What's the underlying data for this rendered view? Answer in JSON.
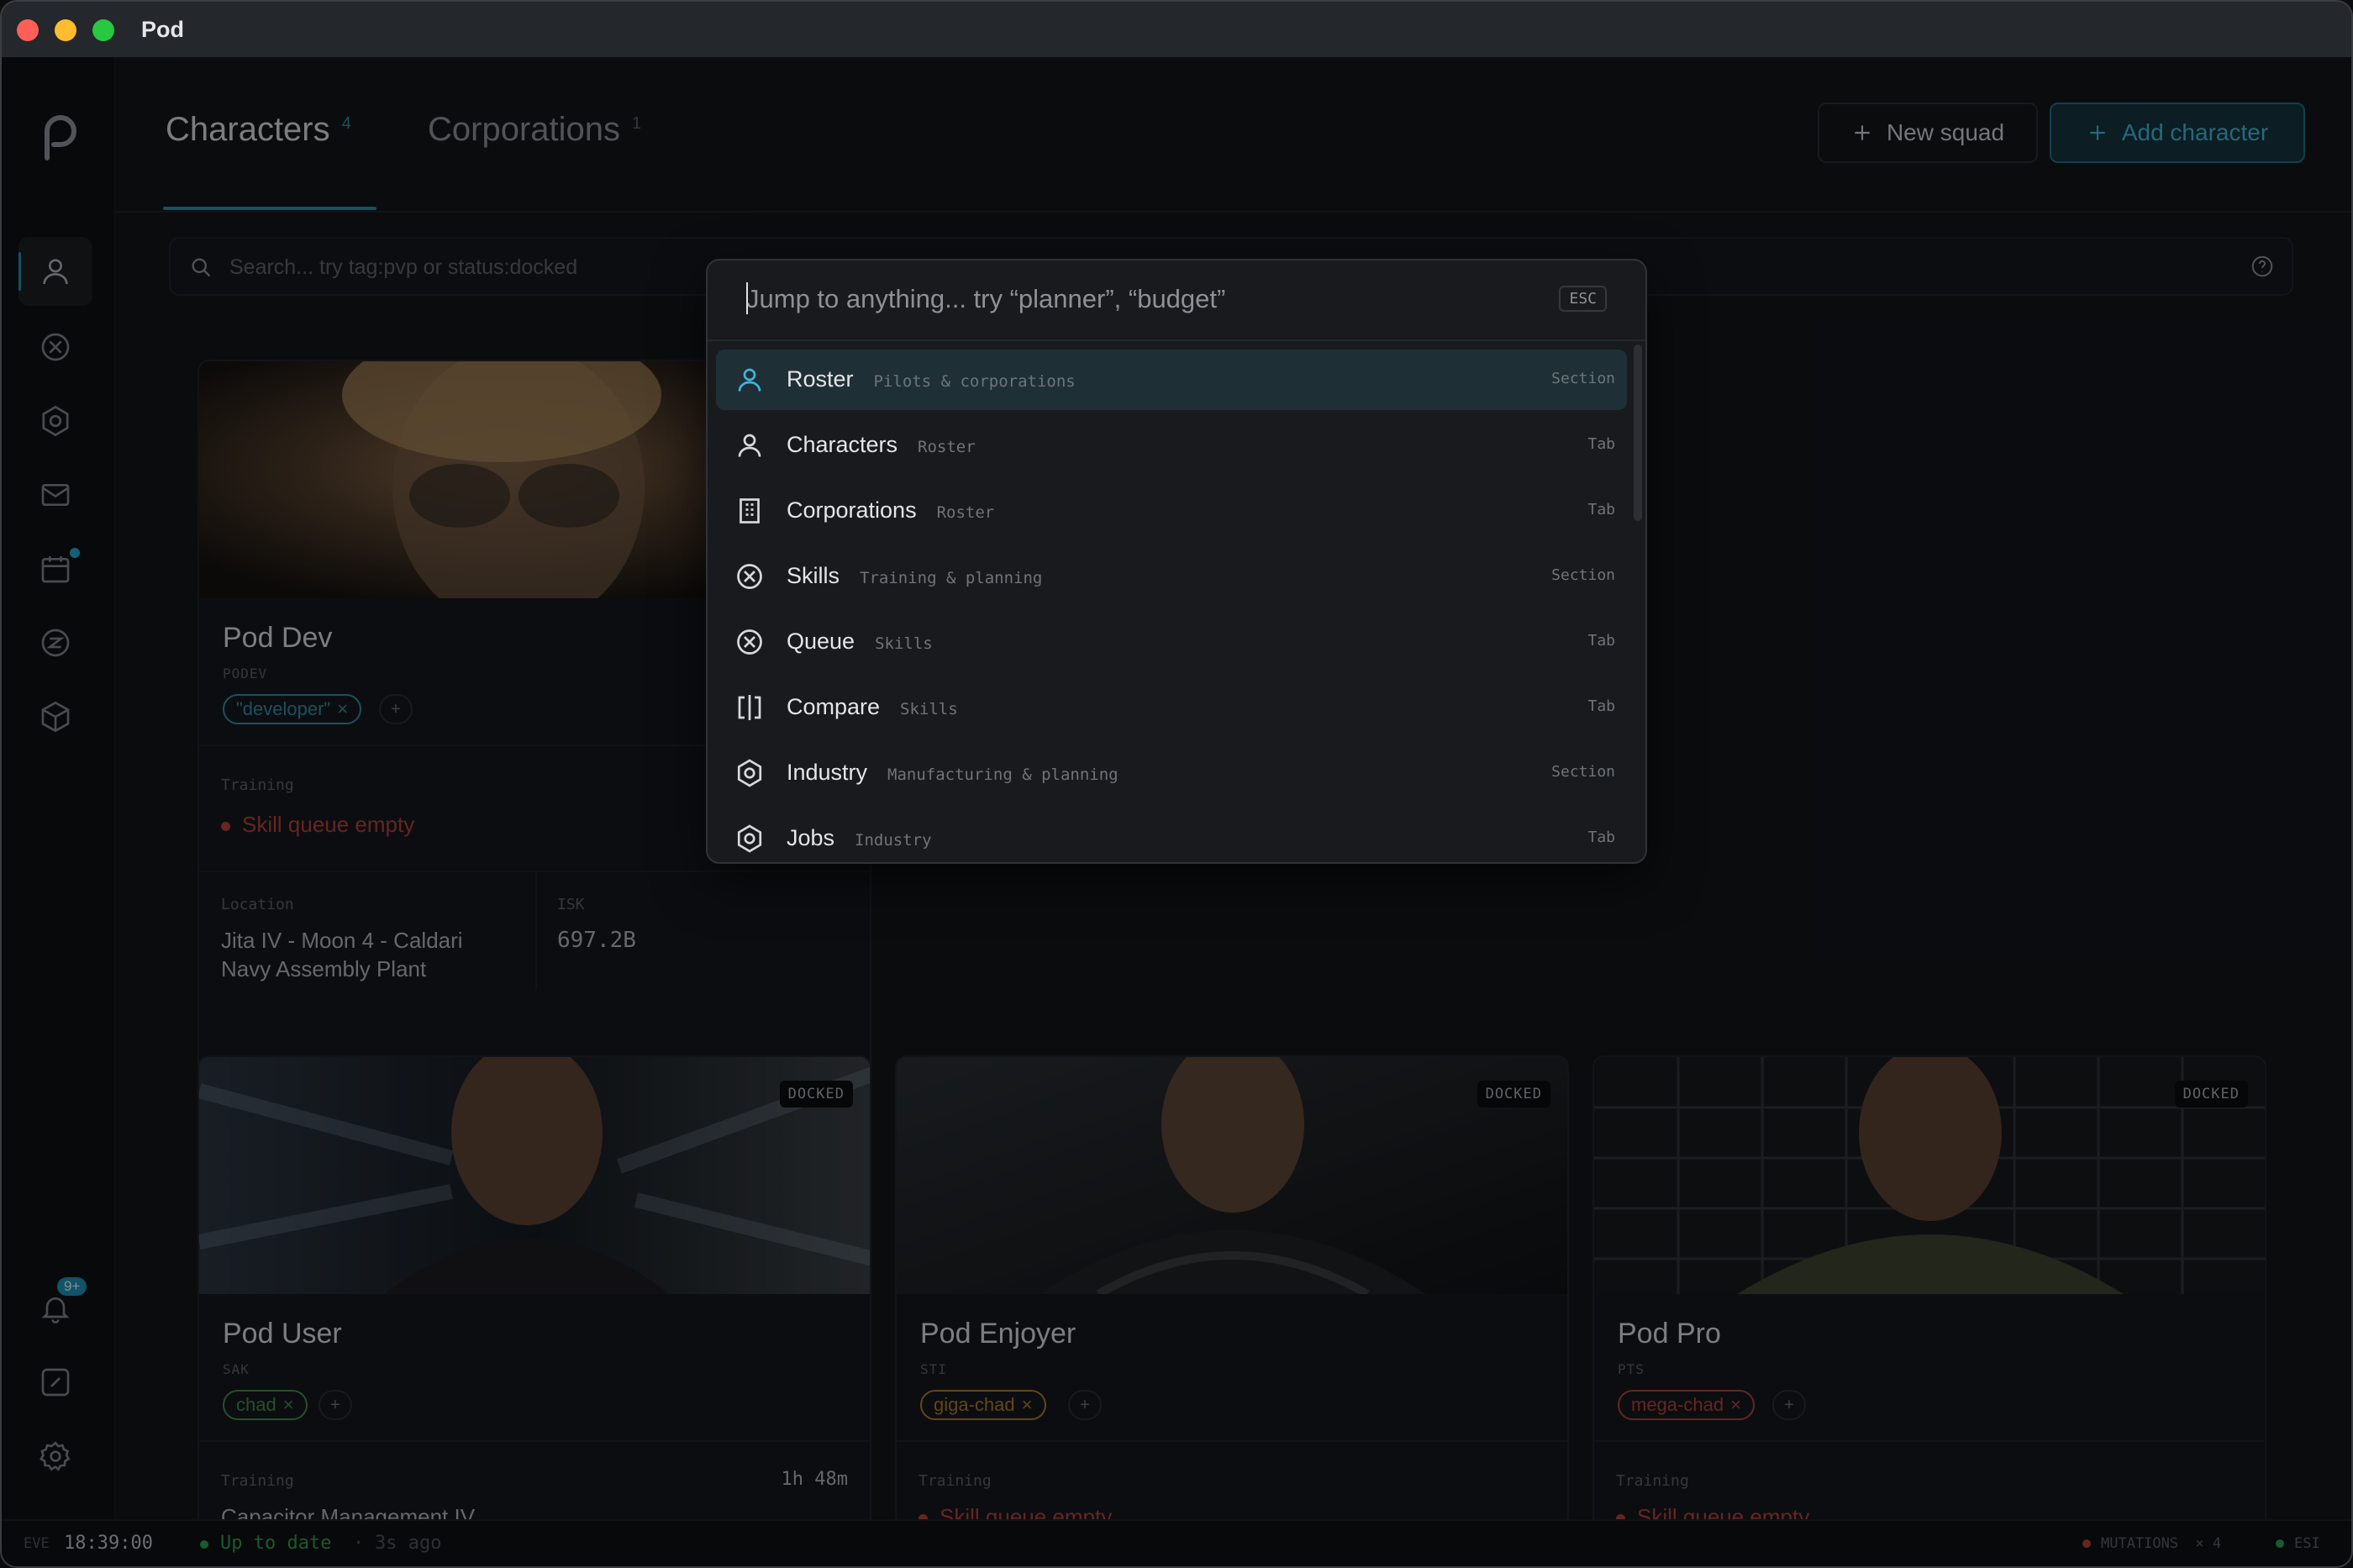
{
  "window": {
    "title": "Pod"
  },
  "header": {
    "tabs": [
      {
        "label": "Characters",
        "count": "4"
      },
      {
        "label": "Corporations",
        "count": "1"
      }
    ],
    "new_squad": "New squad",
    "add_character": "Add character"
  },
  "search": {
    "placeholder": "Search... try tag:pvp or status:docked"
  },
  "sidebar": {
    "items": [
      {
        "name": "roster",
        "icon": "user-icon",
        "active": true
      },
      {
        "name": "skills",
        "icon": "skills-icon"
      },
      {
        "name": "industry",
        "icon": "industry-icon"
      },
      {
        "name": "mail",
        "icon": "mail-icon"
      },
      {
        "name": "calendar",
        "icon": "calendar-icon",
        "dot": true
      },
      {
        "name": "wallet",
        "icon": "isk-icon"
      },
      {
        "name": "assets",
        "icon": "box-icon"
      }
    ],
    "bottom": {
      "notifications_badge": "9+"
    }
  },
  "cards": [
    {
      "name": "Pod Dev",
      "ticker": "PODEV",
      "tags": [
        {
          "label": "\"developer\"",
          "color": "#2a8ea8"
        }
      ],
      "training_label": "Training",
      "training_status": "Skill queue empty",
      "location_label": "Location",
      "location_line1": "Jita IV - Moon 4 - Caldari",
      "location_line2": "Navy Assembly Plant",
      "isk_label": "ISK",
      "isk_value": "697.2B"
    },
    {
      "name": "Pod User",
      "ticker": "SAK",
      "docked": "DOCKED",
      "tags": [
        {
          "label": "chad",
          "color": "#3f8a4a"
        }
      ],
      "training_label": "Training",
      "training_time": "1h 48m",
      "training_skill": "Capacitor Management IV"
    },
    {
      "name": "Pod Enjoyer",
      "ticker": "STI",
      "docked": "DOCKED",
      "tags": [
        {
          "label": "giga-chad",
          "color": "#a8792a"
        }
      ],
      "training_label": "Training",
      "training_status": "Skill queue empty"
    },
    {
      "name": "Pod Pro",
      "ticker": "PTS",
      "docked": "DOCKED",
      "tags": [
        {
          "label": "mega-chad",
          "color": "#b0413a"
        }
      ],
      "training_label": "Training",
      "training_status": "Skill queue empty"
    }
  ],
  "palette": {
    "placeholder": "Jump to anything... try “planner”, “budget”",
    "esc": "ESC",
    "items": [
      {
        "label": "Roster",
        "sub": "Pilots & corporations",
        "kind": "Section",
        "icon": "user-icon",
        "selected": true
      },
      {
        "label": "Characters",
        "sub": "Roster",
        "kind": "Tab",
        "icon": "user-icon"
      },
      {
        "label": "Corporations",
        "sub": "Roster",
        "kind": "Tab",
        "icon": "building-icon"
      },
      {
        "label": "Skills",
        "sub": "Training & planning",
        "kind": "Section",
        "icon": "skills-icon"
      },
      {
        "label": "Queue",
        "sub": "Skills",
        "kind": "Tab",
        "icon": "skills-icon"
      },
      {
        "label": "Compare",
        "sub": "Skills",
        "kind": "Tab",
        "icon": "compare-icon"
      },
      {
        "label": "Industry",
        "sub": "Manufacturing & planning",
        "kind": "Section",
        "icon": "industry-icon"
      },
      {
        "label": "Jobs",
        "sub": "Industry",
        "kind": "Tab",
        "icon": "industry-icon"
      }
    ]
  },
  "statusbar": {
    "eve_label": "EVE",
    "time": "18:39:00",
    "sync": "Up to date",
    "ago": "3s ago",
    "mutations_label": "MUTATIONS",
    "mutations_count": "× 4",
    "esi": "ESI"
  }
}
